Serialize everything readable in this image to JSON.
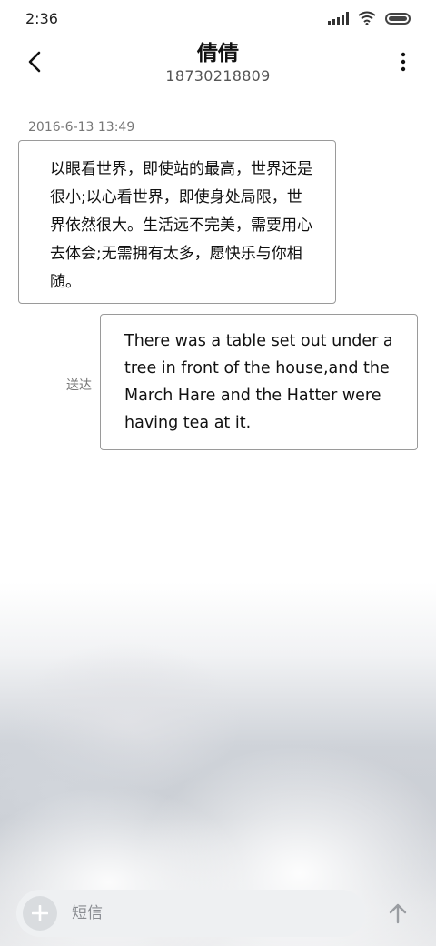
{
  "status_bar": {
    "time": "2:36",
    "icons": [
      "signal-icon",
      "wifi-icon",
      "battery-icon"
    ]
  },
  "header": {
    "contact_name": "倩倩",
    "phone_number": "18730218809",
    "icons": [
      "back-arrow-icon",
      "more-vert-icon"
    ]
  },
  "conversation": {
    "timestamp": "2016-6-13 13:49",
    "messages": [
      {
        "direction": "incoming",
        "text": "以眼看世界，即使站的最高，世界还是很小;以心看世界，即使身处局限，世界依然很大。生活远不完美，需要用心去体会;无需拥有太多，愿快乐与你相随。"
      },
      {
        "direction": "outgoing",
        "status": "送达",
        "text": "There was a table set out under a tree in front of the house,and the March Hare and the Hatter were having tea at it."
      }
    ]
  },
  "composer": {
    "placeholder": "短信",
    "icons": [
      "plus-icon",
      "send-arrow-icon"
    ]
  },
  "colors": {
    "bubble_border": "#9a9a9a",
    "composer_bg": "#eef0f2"
  }
}
